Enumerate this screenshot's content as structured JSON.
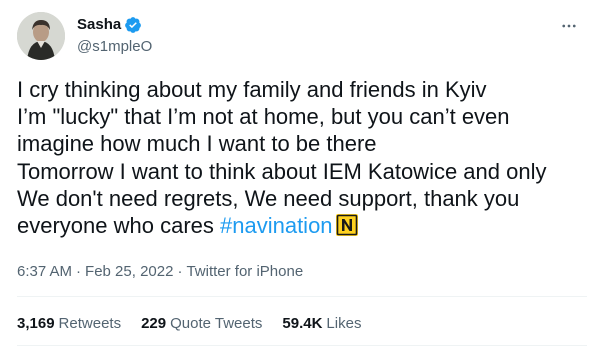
{
  "user": {
    "display_name": "Sasha",
    "handle": "@s1mpleO",
    "verified": true
  },
  "tweet": {
    "lines": [
      "I cry thinking about my family and friends in Kyiv",
      "I’m \"lucky\" that I’m not at home, but you can’t even",
      "imagine how much I want to be there",
      "Tomorrow I want to think about IEM Katowice and only",
      "We don't need regrets, We need support, thank you",
      "everyone who cares "
    ],
    "hashtag": "#navination",
    "emoji": "navi-flag-emoji"
  },
  "meta": {
    "time": "6:37 AM",
    "date": "Feb 25, 2022",
    "source": "Twitter for iPhone"
  },
  "stats": {
    "retweets_count": "3,169",
    "retweets_label": "Retweets",
    "quotes_count": "229",
    "quotes_label": "Quote Tweets",
    "likes_count": "59.4K",
    "likes_label": "Likes"
  },
  "colors": {
    "accent": "#1d9bf0",
    "text": "#0f1419",
    "secondary": "#536471",
    "divider": "#eff3f4"
  }
}
